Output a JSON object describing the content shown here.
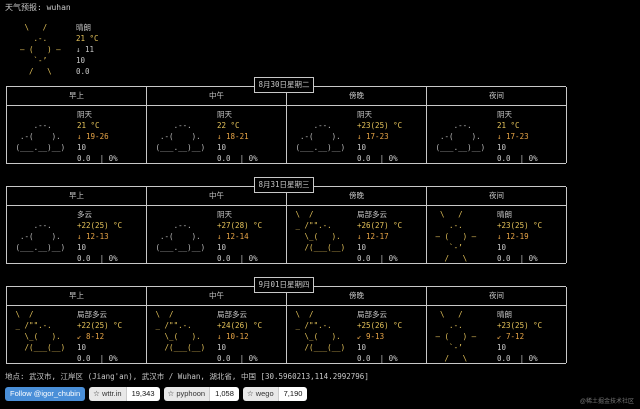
{
  "title": "天气预报:  wuhan",
  "current": {
    "art": " \\   /\n   .-.\n― (   ) ―\n   `-’\n  /   \\",
    "condition": "晴朗",
    "temp": "21 °C",
    "wind": "↓ 11",
    "vis": "10",
    "precip": "0.0"
  },
  "periods": [
    "早上",
    "中午",
    "傍晚",
    "夜间"
  ],
  "days": [
    {
      "date": "8月30日星期二",
      "slots": [
        {
          "art": "\n     .--.\n  .-(    ).\n (___.__)__)",
          "cond": "阴天",
          "temp": "21 °C",
          "wind": "↓ 19-26",
          "vis": "10",
          "precip": "0.0  | 0%"
        },
        {
          "art": "\n     .--.\n  .-(    ).\n (___.__)__)",
          "cond": "阴天",
          "temp": "22 °C",
          "wind": "↓ 18-21",
          "vis": "10",
          "precip": "0.0  | 0%"
        },
        {
          "art": "\n     .--.\n  .-(    ).\n (___.__)__)",
          "cond": "阴天",
          "temp": "+23(25) °C",
          "wind": "↓ 17-23",
          "vis": "10",
          "precip": "0.0  | 0%"
        },
        {
          "art": "\n     .--.\n  .-(    ).\n (___.__)__)",
          "cond": "阴天",
          "temp": "21 °C",
          "wind": "↓ 17-23",
          "vis": "10",
          "precip": "0.0  | 0%"
        }
      ]
    },
    {
      "date": "8月31日星期三",
      "slots": [
        {
          "art": "\n     .--.\n  .-(    ).\n (___.__)__)",
          "cond": "多云",
          "temp": "+22(25) °C",
          "wind": "↓ 12-13",
          "vis": "10",
          "precip": "0.0  | 0%"
        },
        {
          "art": "\n     .--.\n  .-(    ).\n (___.__)__)",
          "cond": "阴天",
          "temp": "+27(28) °C",
          "wind": "↓ 12-14",
          "vis": "10",
          "precip": "0.0  | 0%"
        },
        {
          "art": " \\  /\n _ /\"\".-.\n   \\_(   ).\n   /(___(__)",
          "cond": "局部多云",
          "temp": "+26(27) °C",
          "wind": "↓ 12-17",
          "vis": "10",
          "precip": "0.0  | 0%"
        },
        {
          "art": "  \\   /\n    .-.\n ― (   ) ―\n    `-’\n   /   \\",
          "cond": "晴朗",
          "temp": "+23(25) °C",
          "wind": "↓ 12-19",
          "vis": "10",
          "precip": "0.0  | 0%"
        }
      ]
    },
    {
      "date": "9月01日星期四",
      "slots": [
        {
          "art": " \\  /\n _ /\"\".-.\n   \\_(   ).\n   /(___(__)",
          "cond": "局部多云",
          "temp": "+22(25) °C",
          "wind": "↙ 8-12",
          "vis": "10",
          "precip": "0.0  | 0%"
        },
        {
          "art": " \\  /\n _ /\"\".-.\n   \\_(   ).\n   /(___(__)",
          "cond": "局部多云",
          "temp": "+24(26) °C",
          "wind": "↓ 10-12",
          "vis": "10",
          "precip": "0.0  | 0%"
        },
        {
          "art": " \\  /\n _ /\"\".-.\n   \\_(   ).\n   /(___(__)",
          "cond": "局部多云",
          "temp": "+25(26) °C",
          "wind": "↙ 9-13",
          "vis": "10",
          "precip": "0.0  | 0%"
        },
        {
          "art": "  \\   /\n    .-.\n ― (   ) ―\n    `-’\n   /   \\",
          "cond": "晴朗",
          "temp": "+23(25) °C",
          "wind": "↙ 7-12",
          "vis": "10",
          "precip": "0.0  | 0%"
        }
      ]
    }
  ],
  "location": "地点: 武汉市, 江岸区 (Jiang'an), 武汉市 / Wuhan, 湖北省, 中国 [30.5960213,114.2992796]",
  "badges": [
    {
      "type": "follow",
      "label": "Follow @igor_chubin"
    },
    {
      "label": "☆ wttr.in",
      "count": "19,343"
    },
    {
      "label": "☆ pyphoon",
      "count": "1,058"
    },
    {
      "label": "☆ wego",
      "count": "7,190"
    }
  ],
  "watermark": "@稀土掘金技术社区"
}
